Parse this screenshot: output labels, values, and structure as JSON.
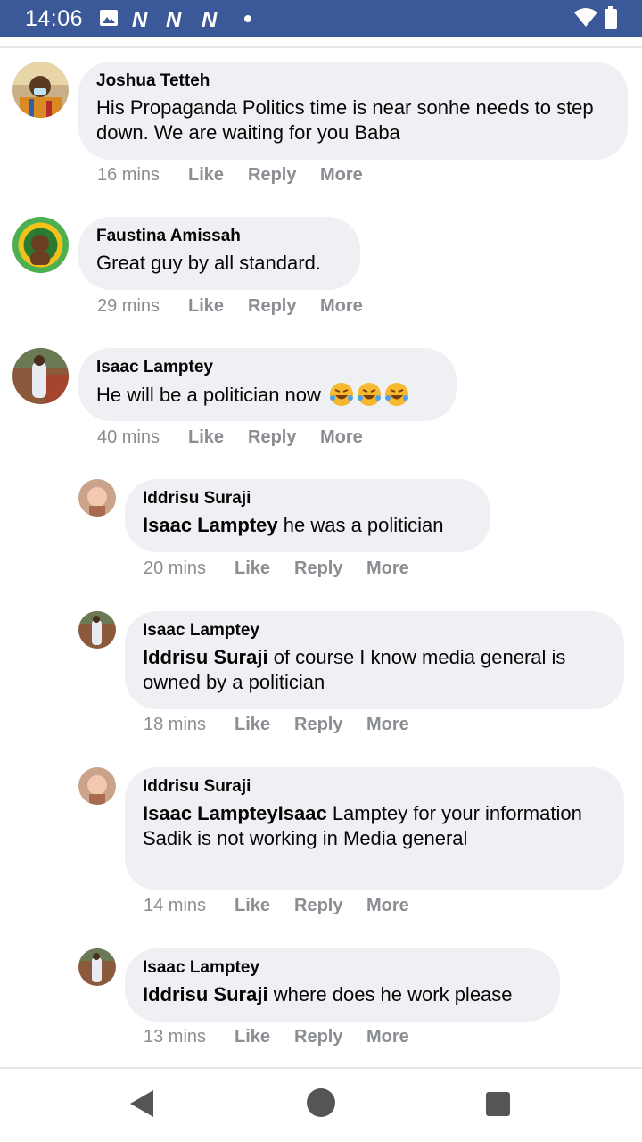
{
  "status_bar": {
    "time": "14:06",
    "icons": [
      "gallery-icon",
      "n-app-icon",
      "n-app-icon",
      "n-app-icon",
      "notification-dot-icon",
      "wifi-icon",
      "battery-icon"
    ],
    "n_label": "N",
    "background": "#3b5998"
  },
  "comments": [
    {
      "author": "Joshua Tetteh",
      "mention": "",
      "text": "His Propaganda Politics time is near sonhe needs to step down. We are waiting for you Baba",
      "time": "16 mins",
      "like": "Like",
      "reply": "Reply",
      "more": "More"
    },
    {
      "author": "Faustina Amissah",
      "mention": "",
      "text": "Great guy by all standard.",
      "time": "29 mins",
      "like": "Like",
      "reply": "Reply",
      "more": "More"
    },
    {
      "author": "Isaac Lamptey",
      "mention": "",
      "text": "He will be a politician now",
      "emoji": [
        "rofl-emoji",
        "rofl-emoji",
        "rofl-emoji"
      ],
      "time": "40 mins",
      "like": "Like",
      "reply": "Reply",
      "more": "More"
    },
    {
      "author": "Iddrisu Suraji",
      "mention": "Isaac Lamptey",
      "text": " he was a politician",
      "time": "20 mins",
      "like": "Like",
      "reply": "Reply",
      "more": "More"
    },
    {
      "author": "Isaac Lamptey",
      "mention": "Iddrisu Suraji",
      "text": " of course I know media general is owned by a politician",
      "time": "18 mins",
      "like": "Like",
      "reply": "Reply",
      "more": "More"
    },
    {
      "author": "Iddrisu Suraji",
      "mention": "Isaac LampteyIsaac",
      "text": " Lamptey for your information Sadik is not working in Media general",
      "time": "14 mins",
      "like": "Like",
      "reply": "Reply",
      "more": "More"
    },
    {
      "author": "Isaac Lamptey",
      "mention": "Iddrisu Suraji",
      "text": " where does he work please",
      "time": "13 mins",
      "like": "Like",
      "reply": "Reply",
      "more": "More"
    }
  ],
  "colors": {
    "bubble": "#eff0f3",
    "meta_text": "#8a8d91",
    "nav_icon": "#555555"
  },
  "nav_bar": {
    "icons": [
      "back-icon",
      "home-icon",
      "recent-apps-icon"
    ]
  }
}
